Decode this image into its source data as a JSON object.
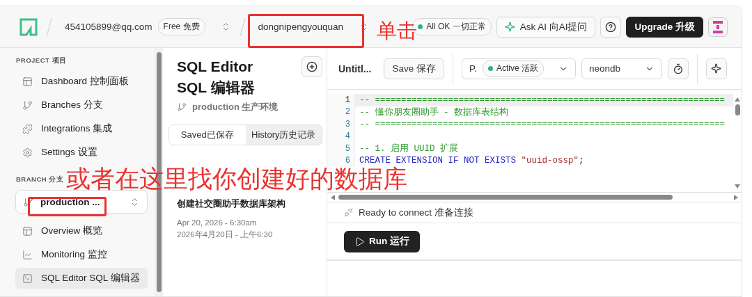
{
  "topbar": {
    "account": "454105899@qq.com",
    "plan": "Free 免费",
    "project": "dongnipengyouquan",
    "status": "All OK 一切正常",
    "ask_ai": "Ask AI 向AI提问",
    "upgrade": "Upgrade 升级"
  },
  "sidebar": {
    "project_heading": "PROJECT 项目",
    "project_items": [
      {
        "label": "Dashboard 控制面板",
        "selected": false
      },
      {
        "label": "Branches 分支",
        "selected": false
      },
      {
        "label": "Integrations 集成",
        "selected": false
      },
      {
        "label": "Settings 设置",
        "selected": false
      }
    ],
    "branch_heading": "BRANCH 分支",
    "branch_select": "production ...",
    "branch_items": [
      {
        "label": "Overview 概览",
        "selected": false
      },
      {
        "label": "Monitoring 监控",
        "selected": false
      },
      {
        "label": "SQL Editor SQL 编辑器",
        "selected": true
      }
    ]
  },
  "history_panel": {
    "title": "SQL Editor",
    "title_cn": "SQL 编辑器",
    "branch": "production 生产环境",
    "tabs": [
      {
        "label": "Saved已保存",
        "selected": true
      },
      {
        "label": "History历史记录",
        "selected": false
      }
    ],
    "entries": [
      {
        "description": "创建社交圈助手数据库架构",
        "date": "Apr 20, 2026 - 6:30am",
        "date_cn": "2026年4月20日 - 上午6:30"
      }
    ]
  },
  "editor": {
    "query_title": "Untitl...",
    "save": "Save 保存",
    "compute": "P.",
    "compute_status": "Active 活跃",
    "database": "neondb",
    "lines": [
      {
        "number": "1",
        "selected": true,
        "tokens": [
          {
            "kind": "comment",
            "text": "-- ==================================================================="
          }
        ]
      },
      {
        "number": "2",
        "selected": false,
        "tokens": [
          {
            "kind": "comment",
            "text": "-- 懂你朋友圈助手 - 数据库表结构"
          }
        ]
      },
      {
        "number": "3",
        "selected": false,
        "tokens": [
          {
            "kind": "comment",
            "text": "-- ==================================================================="
          }
        ]
      },
      {
        "number": "4",
        "selected": false
      },
      {
        "number": "5",
        "selected": false,
        "tokens": [
          {
            "kind": "comment",
            "text": "-- 1. 启用 UUID 扩展"
          }
        ]
      },
      {
        "number": "6",
        "selected": false,
        "tokens": [
          {
            "kind": "keyword",
            "text": "CREATE EXTENSION IF NOT EXISTS "
          },
          {
            "kind": "string",
            "text": "\"uuid-ossp\""
          },
          {
            "kind": "plain",
            "text": ";"
          }
        ]
      }
    ],
    "status": "Ready to connect 准备连接",
    "run": "Run 运行"
  },
  "annotations": [
    "单击",
    "或者在这里找你创建好的数据库"
  ]
}
